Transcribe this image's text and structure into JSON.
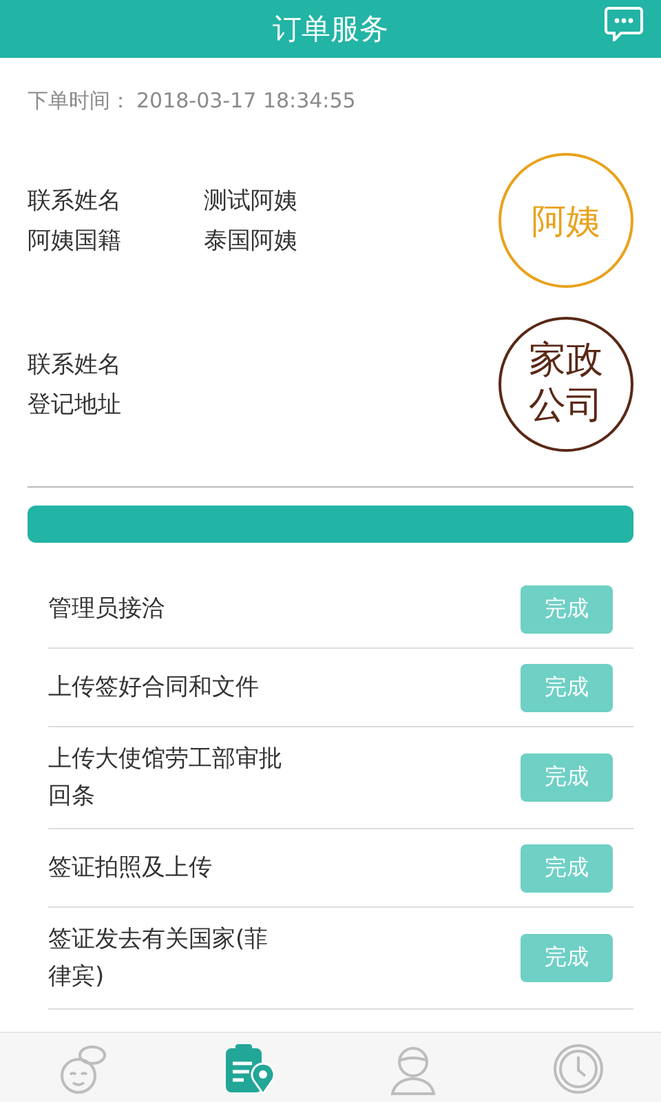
{
  "header": {
    "title": "订单服务"
  },
  "order_time": {
    "label": "下单时间：",
    "value": "2018-03-17 18:34:55"
  },
  "contacts": [
    {
      "kind": "helper",
      "badge": "阿姨",
      "fields": [
        {
          "label": "联系姓名",
          "value": "测试阿姨"
        },
        {
          "label": "阿姨国籍",
          "value": "泰国阿姨"
        }
      ]
    },
    {
      "kind": "company",
      "badge": "家政公司",
      "fields": [
        {
          "label": "联系姓名"
        },
        {
          "label": "登记地址"
        }
      ]
    }
  ],
  "steps": [
    {
      "label": "管理员接洽",
      "button": "完成"
    },
    {
      "label": "上传签好合同和文件",
      "button": "完成"
    },
    {
      "label": "上传大使馆劳工部审批回条",
      "button": "完成"
    },
    {
      "label": "签证拍照及上传",
      "button": "完成"
    },
    {
      "label": "签证发去有关国家(菲律宾)",
      "button": "完成"
    }
  ],
  "tab_bar": [
    {
      "kind": "helper",
      "selected": false
    },
    {
      "kind": "order",
      "selected": true
    },
    {
      "kind": "user",
      "selected": false
    },
    {
      "kind": "clock",
      "selected": false
    }
  ]
}
